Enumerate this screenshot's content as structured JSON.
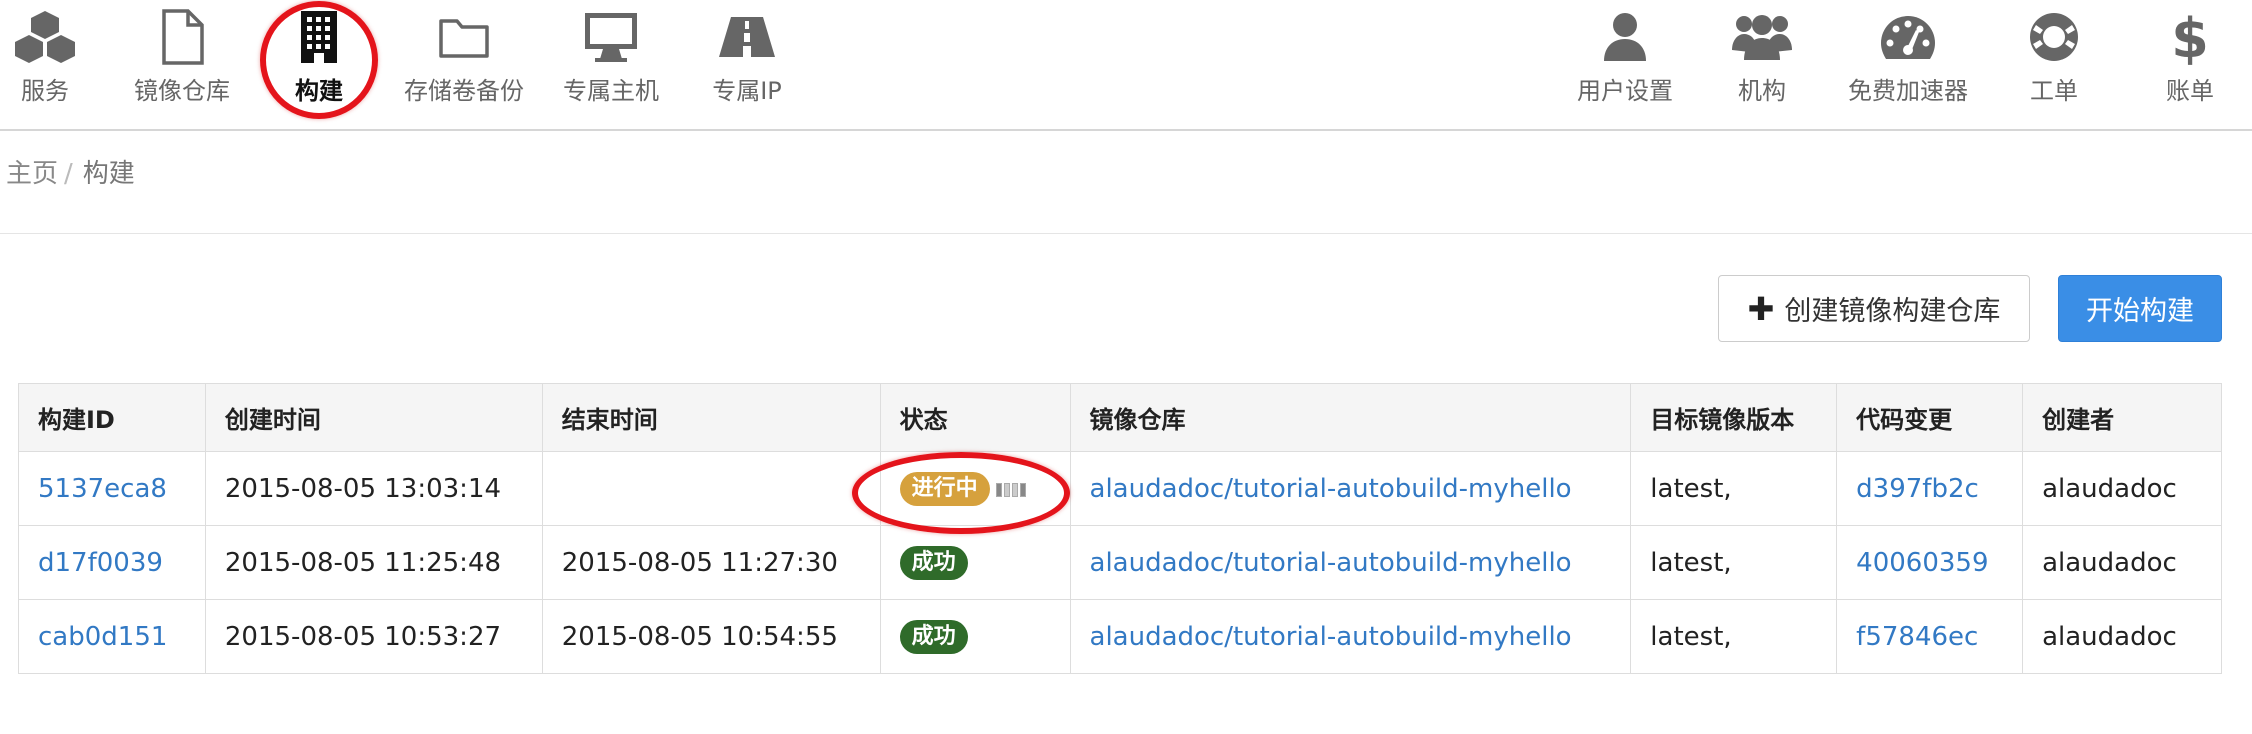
{
  "nav": {
    "left": [
      {
        "label": "服务",
        "icon": "cubes-icon"
      },
      {
        "label": "镜像仓库",
        "icon": "file-icon"
      },
      {
        "label": "构建",
        "icon": "building-icon"
      },
      {
        "label": "存储卷备份",
        "icon": "folder-icon"
      },
      {
        "label": "专属主机",
        "icon": "desktop-icon"
      },
      {
        "label": "专属IP",
        "icon": "road-icon"
      }
    ],
    "right": [
      {
        "label": "用户设置",
        "icon": "user-icon"
      },
      {
        "label": "机构",
        "icon": "users-icon"
      },
      {
        "label": "免费加速器",
        "icon": "dashboard-icon"
      },
      {
        "label": "工单",
        "icon": "lifebuoy-icon"
      },
      {
        "label": "账单",
        "icon": "dollar-icon"
      }
    ],
    "active": "构建"
  },
  "breadcrumb": {
    "home": "主页",
    "separator": "/",
    "current": "构建"
  },
  "actions": {
    "create_repo": "创建镜像构建仓库",
    "start_build": "开始构建"
  },
  "table": {
    "headers": [
      "构建ID",
      "创建时间",
      "结束时间",
      "状态",
      "镜像仓库",
      "目标镜像版本",
      "代码变更",
      "创建者"
    ],
    "rows": [
      {
        "id": "5137eca8",
        "created": "2015-08-05 13:03:14",
        "ended": "",
        "status": "进行中",
        "repo": "alaudadoc/tutorial-autobuild-myhello",
        "tag": "latest,",
        "commit": "d397fb2c",
        "creator": "alaudadoc"
      },
      {
        "id": "d17f0039",
        "created": "2015-08-05 11:25:48",
        "ended": "2015-08-05 11:27:30",
        "status": "成功",
        "repo": "alaudadoc/tutorial-autobuild-myhello",
        "tag": "latest,",
        "commit": "40060359",
        "creator": "alaudadoc"
      },
      {
        "id": "cab0d151",
        "created": "2015-08-05 10:53:27",
        "ended": "2015-08-05 10:54:55",
        "status": "成功",
        "repo": "alaudadoc/tutorial-autobuild-myhello",
        "tag": "latest,",
        "commit": "f57846ec",
        "creator": "alaudadoc"
      }
    ]
  },
  "colors": {
    "link": "#3279c4",
    "primary": "#3a8ee6",
    "running": "#d6a13d",
    "success": "#2f6b2a",
    "highlight": "#e4141b"
  }
}
